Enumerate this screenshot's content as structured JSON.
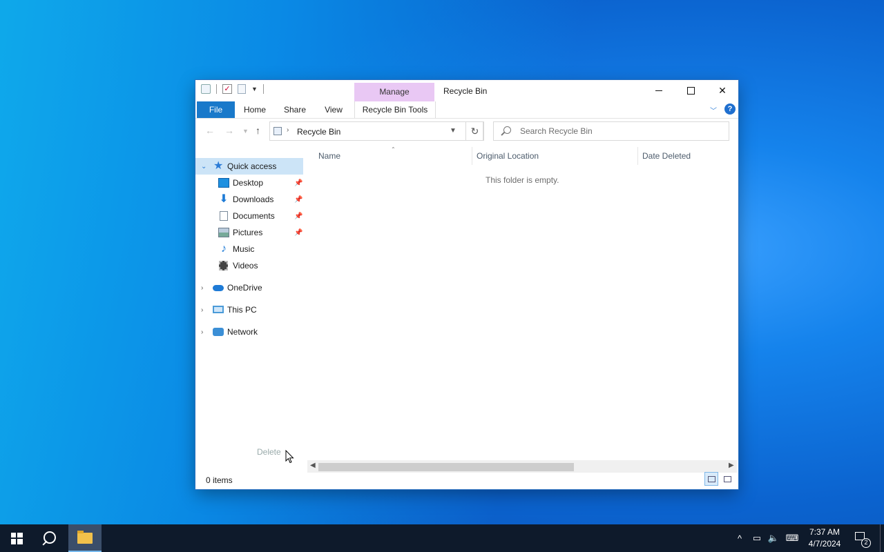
{
  "window": {
    "title": "Recycle Bin",
    "ribbon": {
      "context_group": "Manage",
      "tabs": [
        "File",
        "Home",
        "Share",
        "View",
        "Recycle Bin Tools"
      ]
    },
    "address": {
      "path": "Recycle Bin"
    },
    "search": {
      "placeholder": "Search Recycle Bin"
    },
    "nav": {
      "quick_access": "Quick access",
      "items": [
        "Desktop",
        "Downloads",
        "Documents",
        "Pictures",
        "Music",
        "Videos"
      ],
      "onedrive": "OneDrive",
      "this_pc": "This PC",
      "network": "Network"
    },
    "columns": [
      "Name",
      "Original Location",
      "Date Deleted"
    ],
    "empty_message": "This folder is empty.",
    "drag_ghost_label": "Delete",
    "status": "0 items"
  },
  "taskbar": {
    "time": "7:37 AM",
    "date": "4/7/2024",
    "notification_count": "2"
  },
  "colors": {
    "file_tab": "#1979ca",
    "manage_tab": "#e9c8f4",
    "selection": "#cce4f7",
    "taskbar": "#0e1a2b"
  }
}
